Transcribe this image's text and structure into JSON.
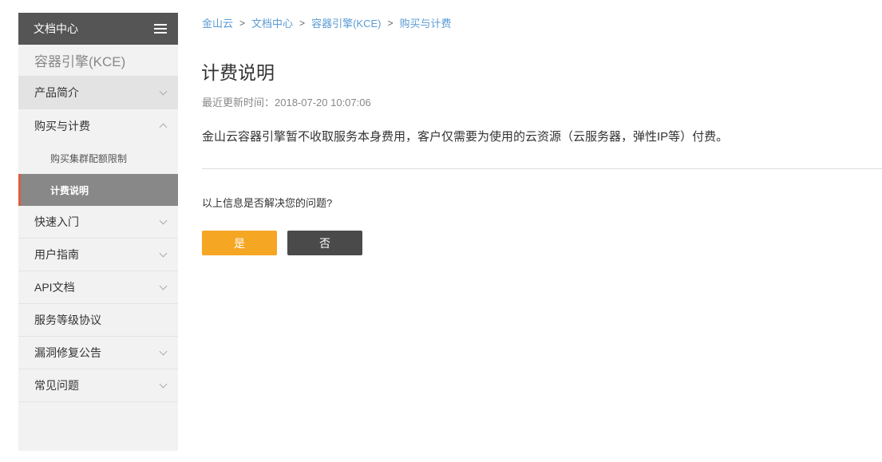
{
  "sidebar": {
    "header_title": "文档中心",
    "product": "容器引擎(KCE)",
    "items": [
      {
        "label": "产品简介"
      },
      {
        "label": "购买与计费"
      },
      {
        "label": "快速入门"
      },
      {
        "label": "用户指南"
      },
      {
        "label": "API文档"
      },
      {
        "label": "服务等级协议"
      },
      {
        "label": "漏洞修复公告"
      },
      {
        "label": "常见问题"
      }
    ],
    "subitems": [
      {
        "label": "购买集群配额限制"
      },
      {
        "label": "计费说明"
      }
    ]
  },
  "breadcrumb": [
    "金山云",
    "文档中心",
    "容器引擎(KCE)",
    "购买与计费"
  ],
  "breadcrumb_separator": ">",
  "article": {
    "title": "计费说明",
    "updated": "最近更新时间：2018-07-20 10:07:06",
    "body": "金山云容器引擎暂不收取服务本身费用，客户仅需要为使用的云资源（云服务器，弹性IP等）付费。"
  },
  "feedback": {
    "question": "以上信息是否解决您的问题?",
    "yes_label": "是",
    "no_label": "否"
  },
  "colors": {
    "sidebar_header": "#555555",
    "active_item": "#888888",
    "active_accent": "#e25b3e",
    "link": "#5a9bd4",
    "yes_button": "#f5a623",
    "no_button": "#4a4a4a"
  }
}
